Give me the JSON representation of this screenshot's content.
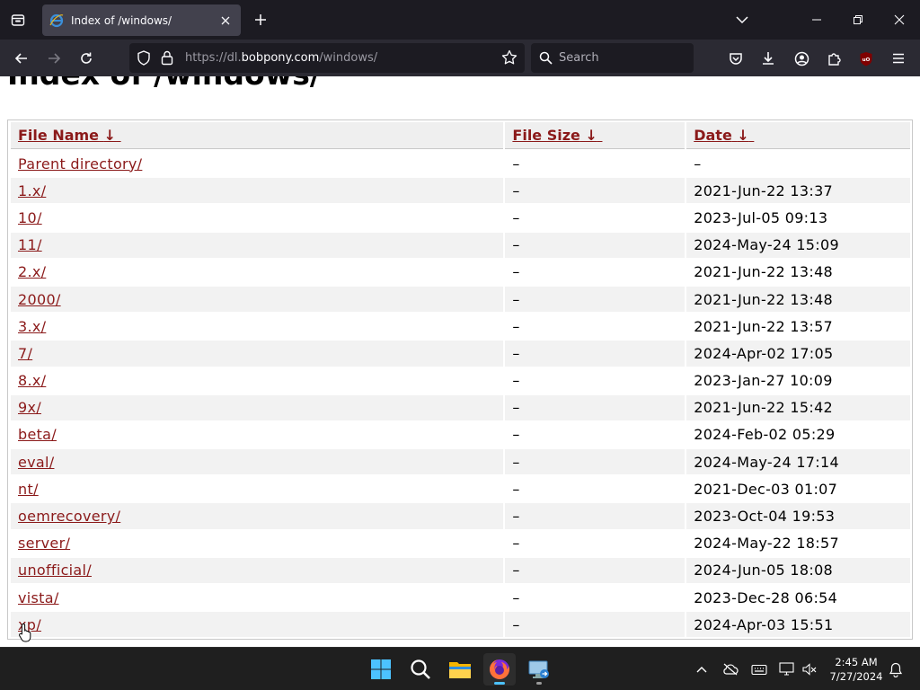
{
  "browser": {
    "tab_title": "Index of /windows/",
    "url_prefix": "https://dl.",
    "url_domain": "bobpony.com",
    "url_path": "/windows/",
    "search_placeholder": "Search"
  },
  "page": {
    "heading": "Index of /windows/",
    "columns": {
      "name": "File Name",
      "size": "File Size",
      "date": "Date",
      "sort_arrow": "↓"
    },
    "rows": [
      {
        "name": "Parent directory/",
        "size": "–",
        "date": "–"
      },
      {
        "name": "1.x/",
        "size": "–",
        "date": "2021-Jun-22 13:37"
      },
      {
        "name": "10/",
        "size": "–",
        "date": "2023-Jul-05 09:13"
      },
      {
        "name": "11/",
        "size": "–",
        "date": "2024-May-24 15:09"
      },
      {
        "name": "2.x/",
        "size": "–",
        "date": "2021-Jun-22 13:48"
      },
      {
        "name": "2000/",
        "size": "–",
        "date": "2021-Jun-22 13:48"
      },
      {
        "name": "3.x/",
        "size": "–",
        "date": "2021-Jun-22 13:57"
      },
      {
        "name": "7/",
        "size": "–",
        "date": "2024-Apr-02 17:05"
      },
      {
        "name": "8.x/",
        "size": "–",
        "date": "2023-Jan-27 10:09"
      },
      {
        "name": "9x/",
        "size": "–",
        "date": "2021-Jun-22 15:42"
      },
      {
        "name": "beta/",
        "size": "–",
        "date": "2024-Feb-02 05:29"
      },
      {
        "name": "eval/",
        "size": "–",
        "date": "2024-May-24 17:14"
      },
      {
        "name": "nt/",
        "size": "–",
        "date": "2021-Dec-03 01:07"
      },
      {
        "name": "oemrecovery/",
        "size": "–",
        "date": "2023-Oct-04 19:53"
      },
      {
        "name": "server/",
        "size": "–",
        "date": "2024-May-22 18:57"
      },
      {
        "name": "unofficial/",
        "size": "–",
        "date": "2024-Jun-05 18:08"
      },
      {
        "name": "vista/",
        "size": "–",
        "date": "2023-Dec-28 06:54"
      },
      {
        "name": "xp/",
        "size": "–",
        "date": "2024-Apr-03 15:51"
      }
    ]
  },
  "taskbar": {
    "time": "2:45 AM",
    "date": "7/27/2024",
    "apps": [
      "start-icon",
      "search-icon",
      "file-explorer-icon",
      "firefox-icon",
      "remote-desktop-icon"
    ]
  },
  "colors": {
    "link": "#8b1a1a",
    "chrome_bg": "#1c1b22",
    "toolbar_bg": "#2b2a33",
    "taskbar_accent": "#4cc2ff"
  }
}
